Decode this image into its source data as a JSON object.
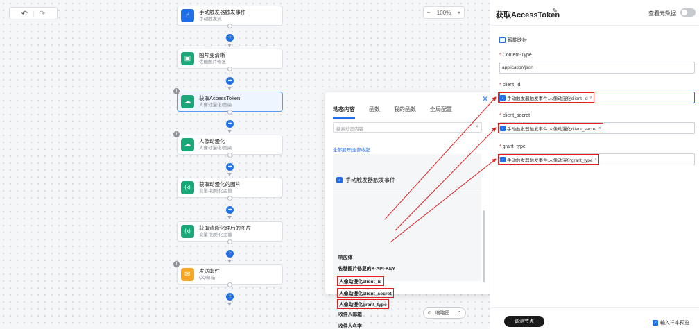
{
  "toolbar": {
    "undo_icon": "undo-icon",
    "redo_icon": "redo-icon",
    "zoom_minus": "−",
    "zoom_value": "100%",
    "zoom_plus": "+"
  },
  "nodes": [
    {
      "title": "手动触发器触发事件",
      "subtitle": "手动触发流",
      "color": "#1f6feb",
      "icon": "hand-tap-icon"
    },
    {
      "title": "图片变清晰",
      "subtitle": "佐糖图片修复",
      "color": "#1aa879",
      "icon": "image-enhance-icon"
    },
    {
      "title": "获取AccessToken",
      "subtitle": "人像动漫化/图染",
      "color": "#1aa879",
      "icon": "cloud-upload-icon"
    },
    {
      "title": "人像动漫化",
      "subtitle": "人像动漫化/图染",
      "color": "#1aa879",
      "icon": "cloud-upload-icon"
    },
    {
      "title": "获取动漫化的图片",
      "subtitle": "变量-初始化变量",
      "color": "#1aa879",
      "icon": "variable-icon"
    },
    {
      "title": "获取清晰化理后的图片",
      "subtitle": "变量-初始化变量",
      "color": "#1aa879",
      "icon": "variable-icon"
    },
    {
      "title": "发送邮件",
      "subtitle": "QQ邮箱",
      "color": "#f5a623",
      "icon": "mail-icon"
    }
  ],
  "minimap": {
    "label": "缩略图"
  },
  "popup": {
    "tabs": [
      "动态内容",
      "函数",
      "我的函数",
      "全局配置"
    ],
    "search_placeholder": "搜索动态内容",
    "expand_all": "全部展开",
    "separator": "|",
    "collapse_all": "全部收起",
    "group_title": "手动触发器触发事件",
    "items": [
      "响应体",
      "佐糖图片修复的X-API-KEY",
      "人像动漫化client_id",
      "人像动漫化client_secret",
      "人像动漫化grant_type",
      "收件人邮箱",
      "收件人名字"
    ]
  },
  "panel": {
    "title": "获取AccessToken",
    "metadata_label": "查看元数据",
    "smart_map": "智能映射",
    "fields": [
      {
        "label": "Content-Type",
        "value": "application/json"
      },
      {
        "label": "client_id",
        "tag": "手动触发器触发事件.人像动漫化client_id",
        "close": "x"
      },
      {
        "label": "client_secret",
        "tag": "手动触发器触发事件.人像动漫化client_secret",
        "close": "x"
      },
      {
        "label": "grant_type",
        "tag": "手动触发器触发事件.人像动漫化grant_type",
        "close": "x"
      }
    ],
    "debug_button": "调测节点",
    "sample_preview": "输入样本预览"
  },
  "colors": {
    "accent": "#1f6feb",
    "highlight": "#e01f1f"
  }
}
